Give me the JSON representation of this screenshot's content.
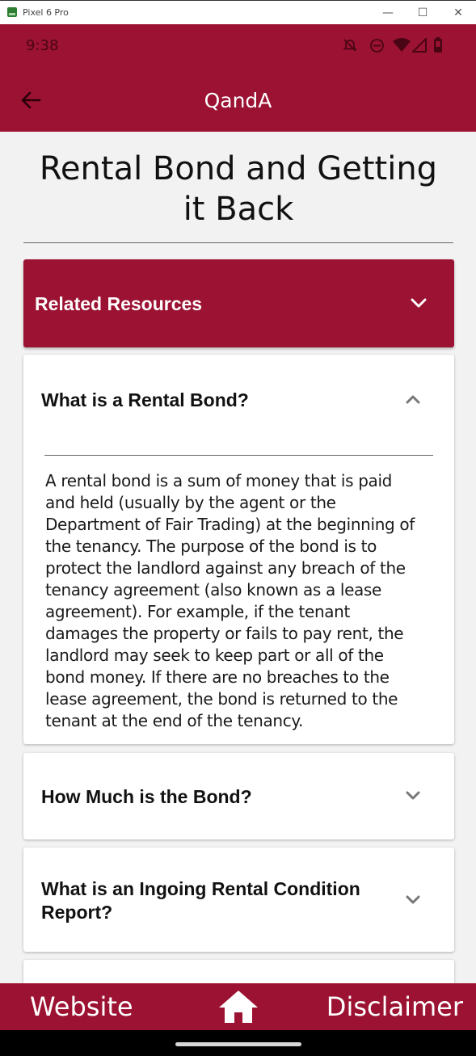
{
  "window": {
    "title": "Pixel 6 Pro",
    "minimize_glyph": "—",
    "maximize_glyph": "☐",
    "close_glyph": "✕"
  },
  "status_bar": {
    "time": "9:38",
    "icons": [
      "alarm-off-icon",
      "do-not-disturb-icon",
      "wifi-icon",
      "signal-icon",
      "battery-icon"
    ]
  },
  "app_bar": {
    "title": "QandA",
    "back_icon": "back-arrow-icon"
  },
  "page": {
    "title": "Rental Bond and Getting it Back"
  },
  "related_resources": {
    "label": "Related Resources",
    "icon": "chevron-down-icon"
  },
  "questions": [
    {
      "question": "What is a Rental Bond?",
      "expanded": true,
      "answer": "A rental bond is a sum of money that is paid and held (usually by the agent or the Department of Fair Trading) at the beginning of the tenancy. The purpose of the bond is to protect the landlord against any breach of the tenancy agreement (also known as a lease agreement). For example, if the tenant damages the property or fails to pay rent, the landlord may seek to keep part or all of the bond money. If there are no breaches to the lease agreement, the bond is returned to the tenant at the end of the tenancy."
    },
    {
      "question": "How Much is the Bond?",
      "expanded": false
    },
    {
      "question": "What is an Ingoing Rental Condition Report?",
      "expanded": false
    }
  ],
  "bottom_nav": {
    "website": "Website",
    "home_icon": "home-icon",
    "disclaimer": "Disclaimer"
  },
  "colors": {
    "brand": "#9c1232",
    "background": "#f2f2f2",
    "card": "#ffffff"
  }
}
